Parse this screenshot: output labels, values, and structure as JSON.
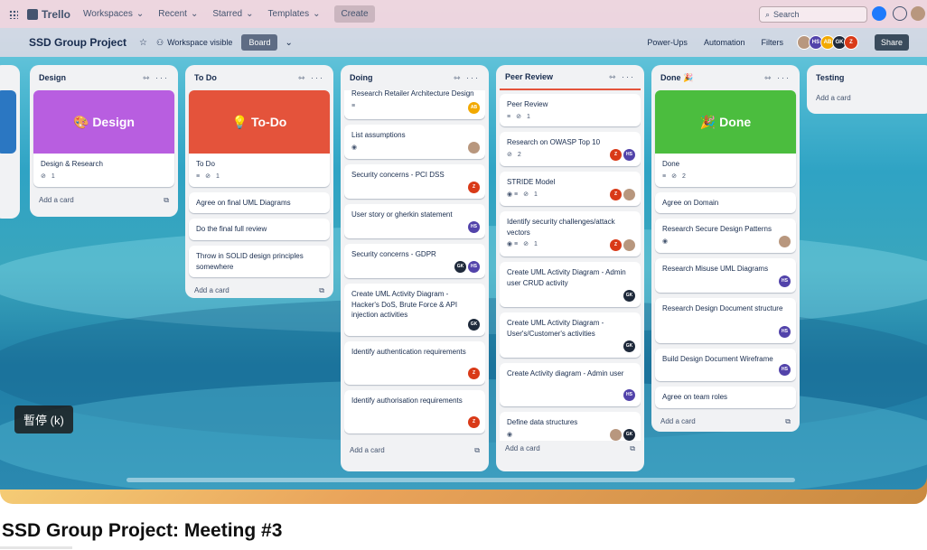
{
  "topnav": {
    "logo": "Trello",
    "items": [
      "Workspaces",
      "Recent",
      "Starred",
      "Templates"
    ],
    "create": "Create",
    "search_placeholder": "Search"
  },
  "board": {
    "title": "SSD Group Project",
    "visibility": "Workspace visible",
    "view": "Board",
    "powerups": "Power-Ups",
    "automation": "Automation",
    "filters": "Filters",
    "share": "Share",
    "members": [
      "HS",
      "AB",
      "GK",
      "Z"
    ]
  },
  "lists": {
    "design": {
      "title": "Design",
      "cover_label": "Design",
      "cards": [
        {
          "title": "Design & Research",
          "attachments": "1"
        }
      ],
      "add": "Add a card"
    },
    "todo": {
      "title": "To Do",
      "cover_label": "To-Do",
      "cards": [
        {
          "title": "To Do",
          "attachments": "1"
        },
        {
          "title": "Agree on final UML Diagrams"
        },
        {
          "title": "Do the final full review"
        },
        {
          "title": "Throw in SOLID design principles somewhere"
        }
      ],
      "add": "Add a card"
    },
    "doing": {
      "title": "Doing",
      "cards": [
        {
          "title": "Research Retailer Architecture Design",
          "member": "AB"
        },
        {
          "title": "List assumptions"
        },
        {
          "title": "Security concerns - PCI DSS",
          "member": "Z"
        },
        {
          "title": "User story or gherkin statement",
          "member": "HS"
        },
        {
          "title": "Security concerns - GDPR",
          "member": "GK",
          "member2": "HS"
        },
        {
          "title": "Create UML Activity Diagram - Hacker's DoS, Brute Force & API injection activities",
          "member": "GK"
        },
        {
          "title": "Identify authentication requirements",
          "member": "Z"
        },
        {
          "title": "Identify authorisation requirements",
          "member": "Z"
        }
      ],
      "add": "Add a card"
    },
    "peer": {
      "title": "Peer Review",
      "cards": [
        {
          "title": "Peer Review",
          "attachments": "1"
        },
        {
          "title": "Research on OWASP Top 10",
          "attachments": "2",
          "member": "HS",
          "member2": "Z"
        },
        {
          "title": "STRIDE Model",
          "attachments": "1",
          "member2": "Z"
        },
        {
          "title": "Identify security challenges/attack vectors",
          "attachments": "1",
          "member2": "Z"
        },
        {
          "title": "Create UML Activity Diagram - Admin user CRUD activity",
          "member": "GK"
        },
        {
          "title": "Create UML Activity Diagram - User's/Customer's activities",
          "member": "GK"
        },
        {
          "title": "Create Activity diagram - Admin user",
          "member": "HS"
        },
        {
          "title": "Define data structures",
          "member": "GK"
        }
      ],
      "add": "Add a card"
    },
    "done": {
      "title": "Done 🎉",
      "cover_label": "Done",
      "cards": [
        {
          "title": "Done",
          "attachments": "2"
        },
        {
          "title": "Agree on Domain"
        },
        {
          "title": "Research Secure Design Patterns"
        },
        {
          "title": "Research Misuse UML Diagrams",
          "member": "HS"
        },
        {
          "title": "Research Design Document structure",
          "member": "HS"
        },
        {
          "title": "Build Design Document Wireframe",
          "member": "HS"
        },
        {
          "title": "Agree on team roles"
        }
      ],
      "add": "Add a card"
    },
    "testing": {
      "title": "Testing",
      "add": "Add a card"
    }
  },
  "player": {
    "pause_tooltip": "暫停 (k)"
  },
  "video_title": "SSD Group Project: Meeting #3",
  "colors": {
    "design_cover": "#b85ee0",
    "todo_cover": "#e4533b",
    "done_cover": "#4bbd3e",
    "peer_accent": "#e4533b"
  }
}
